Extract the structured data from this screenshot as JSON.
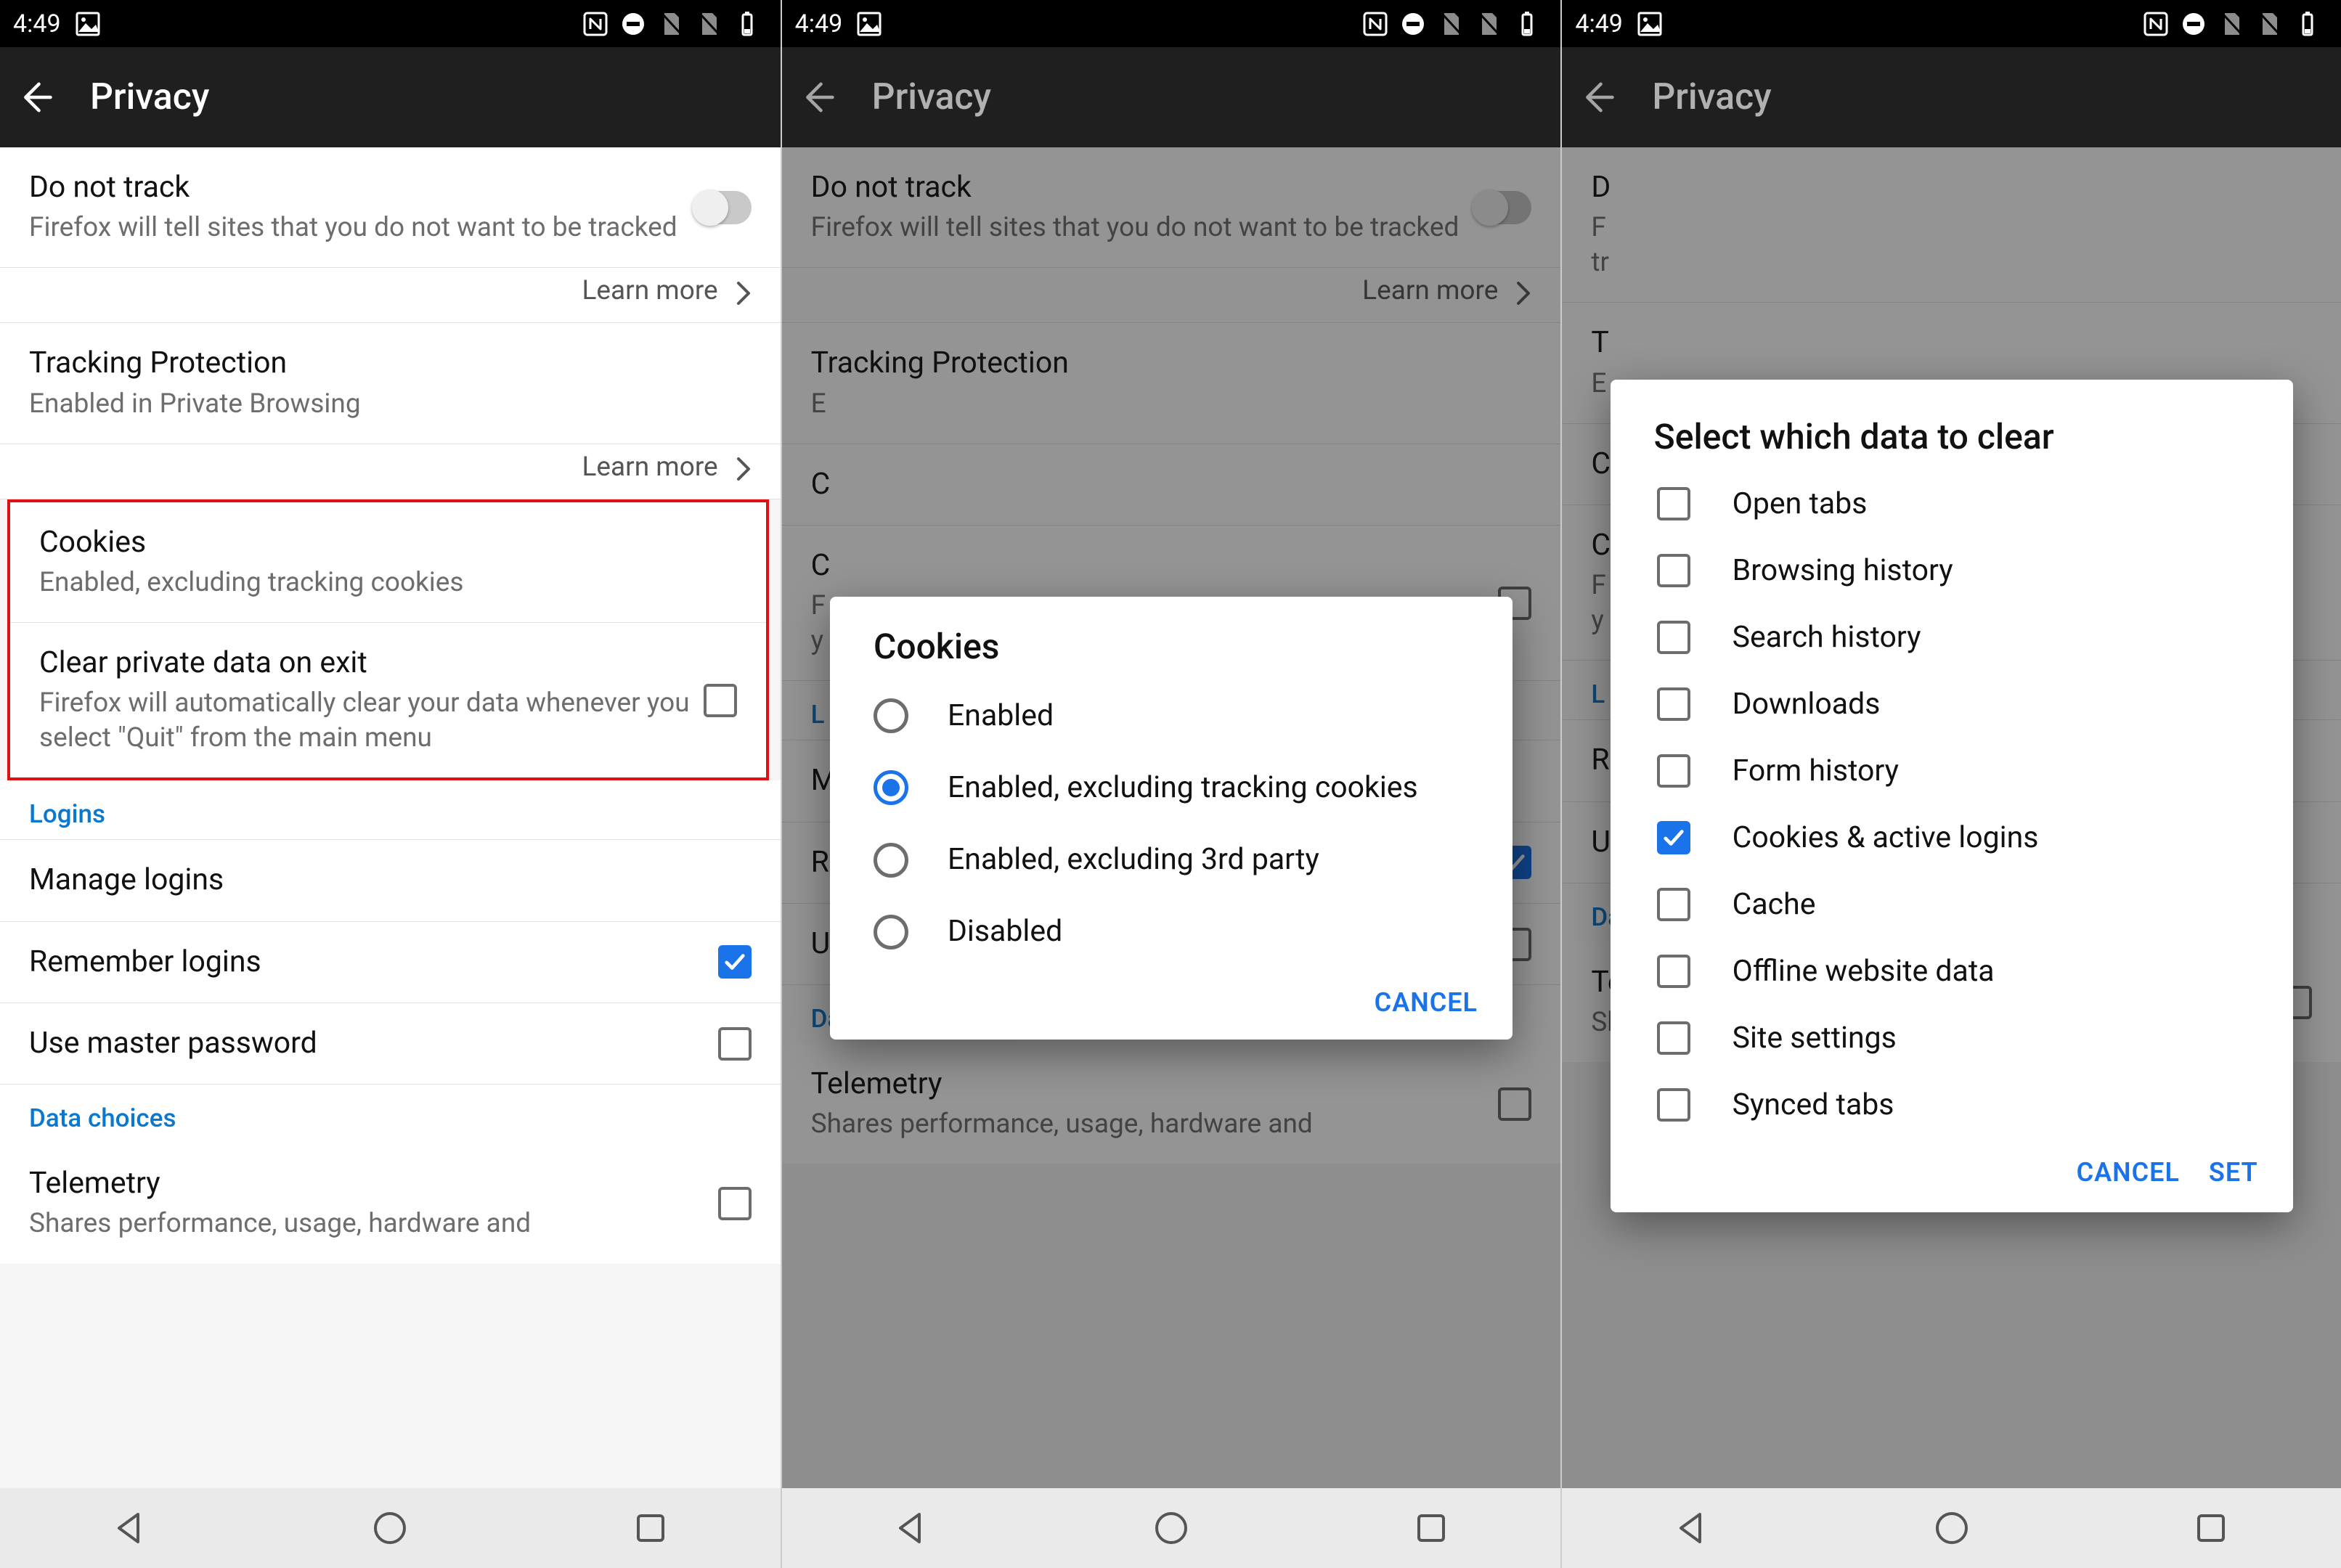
{
  "status": {
    "time": "4:49"
  },
  "appbar": {
    "title": "Privacy"
  },
  "items": {
    "dnt_title": "Do not track",
    "dnt_sub": "Firefox will tell sites that you do not want to be tracked",
    "learn_more": "Learn more",
    "tp_title": "Tracking Protection",
    "tp_sub": "Enabled in Private Browsing",
    "cookies_title": "Cookies",
    "cookies_sub": "Enabled, excluding tracking cookies",
    "clear_title": "Clear private data on exit",
    "clear_sub": "Firefox will automatically clear your data whenever you select \"Quit\" from the main menu",
    "section_logins": "Logins",
    "manage_logins": "Manage logins",
    "remember_logins": "Remember logins",
    "master_pw": "Use master password",
    "section_data": "Data choices",
    "telemetry_title": "Telemetry",
    "telemetry_sub": "Shares performance, usage, hardware and"
  },
  "cookies_dialog": {
    "title": "Cookies",
    "options": {
      "o0": "Enabled",
      "o1": "Enabled, excluding tracking cookies",
      "o2": "Enabled, excluding 3rd party",
      "o3": "Disabled"
    },
    "cancel": "CANCEL"
  },
  "clear_dialog": {
    "title": "Select which data to clear",
    "items": {
      "i0": "Open tabs",
      "i1": "Browsing history",
      "i2": "Search history",
      "i3": "Downloads",
      "i4": "Form history",
      "i5": "Cookies & active logins",
      "i6": "Cache",
      "i7": "Offline website data",
      "i8": "Site settings",
      "i9": "Synced tabs"
    },
    "cancel": "CANCEL",
    "set": "SET"
  }
}
